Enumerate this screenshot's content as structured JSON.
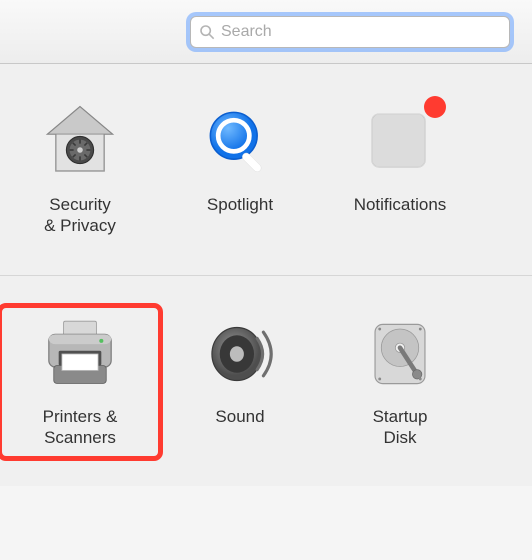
{
  "search": {
    "placeholder": "Search",
    "value": ""
  },
  "rows": [
    {
      "items": [
        {
          "id": "security-privacy",
          "label": "Security\n& Privacy",
          "icon": "house-lock",
          "badge": false,
          "highlighted": false
        },
        {
          "id": "spotlight",
          "label": "Spotlight",
          "icon": "magnifier-blue",
          "badge": false,
          "highlighted": false
        },
        {
          "id": "notifications",
          "label": "Notifications",
          "icon": "notification-square",
          "badge": true,
          "highlighted": false
        }
      ]
    },
    {
      "items": [
        {
          "id": "printers-scanners",
          "label": "Printers &\nScanners",
          "icon": "printer",
          "badge": false,
          "highlighted": true
        },
        {
          "id": "sound",
          "label": "Sound",
          "icon": "speaker",
          "badge": false,
          "highlighted": false
        },
        {
          "id": "startup-disk",
          "label": "Startup\nDisk",
          "icon": "hard-drive",
          "badge": false,
          "highlighted": false
        }
      ]
    }
  ]
}
